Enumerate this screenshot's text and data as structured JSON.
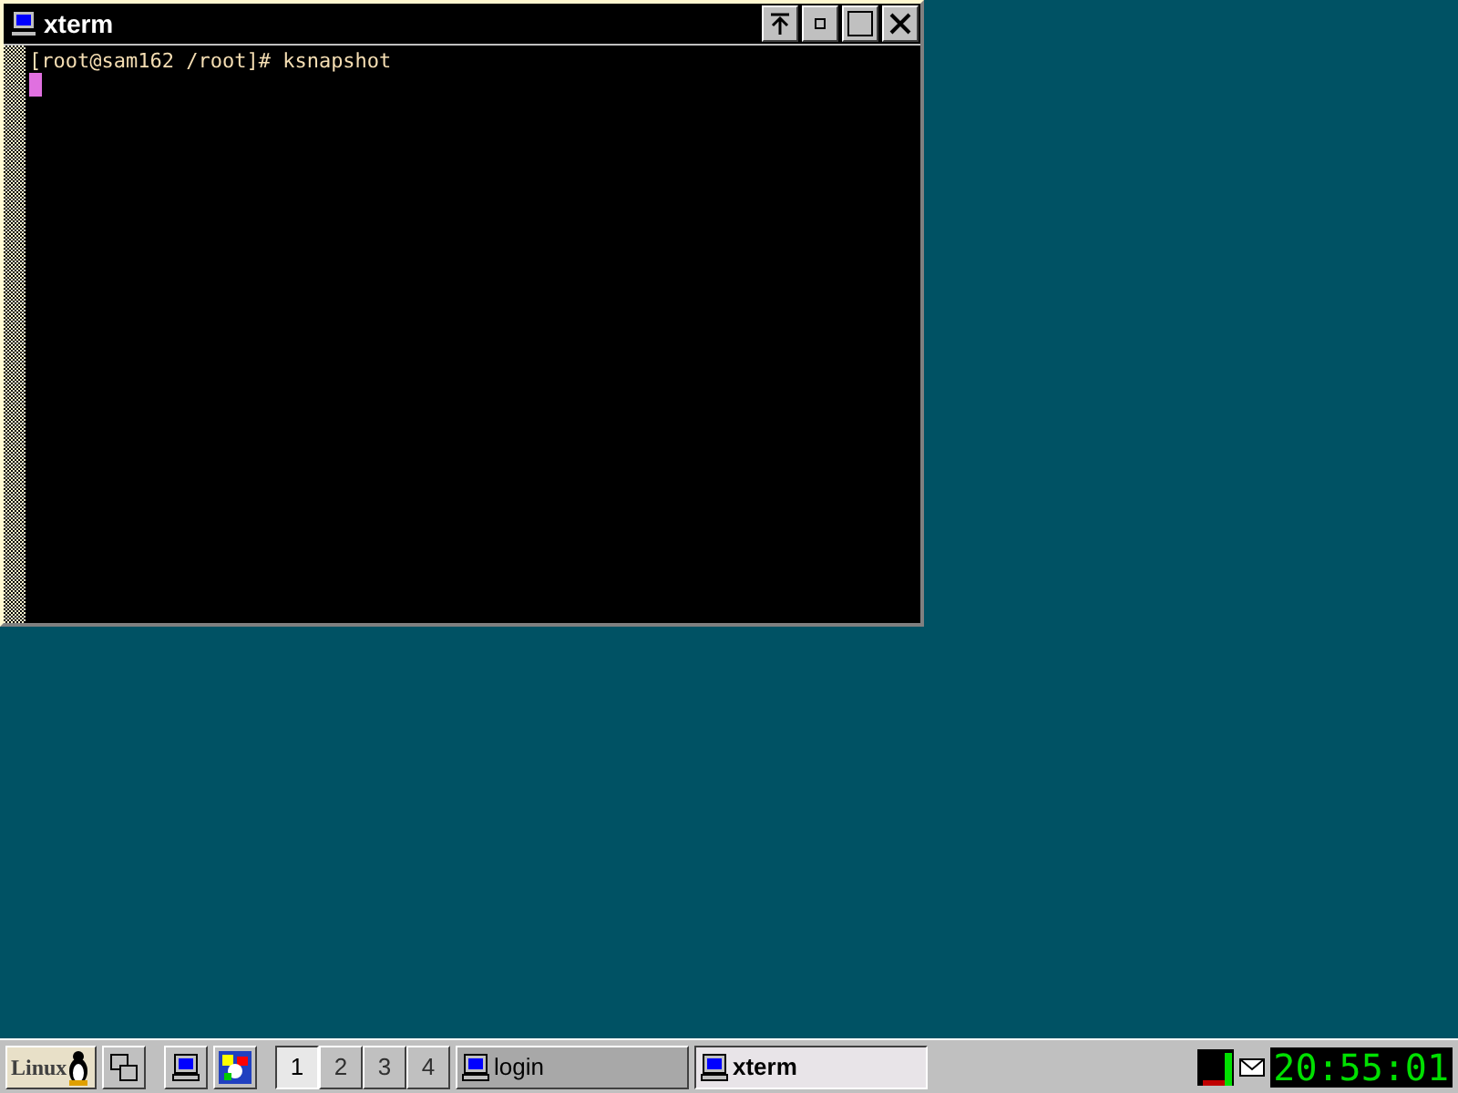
{
  "window": {
    "title": "xterm",
    "lines": [
      "[root@sam162 /root]# ksnapshot"
    ]
  },
  "taskbar": {
    "start_label": "Linux",
    "desktops": [
      {
        "label": "1",
        "selected": true
      },
      {
        "label": "2",
        "selected": false
      },
      {
        "label": "3",
        "selected": false
      },
      {
        "label": "4",
        "selected": false
      }
    ],
    "tasks": [
      {
        "label": "login",
        "selected": false
      },
      {
        "label": "xterm",
        "selected": true
      }
    ],
    "clock": "20:55:01"
  }
}
